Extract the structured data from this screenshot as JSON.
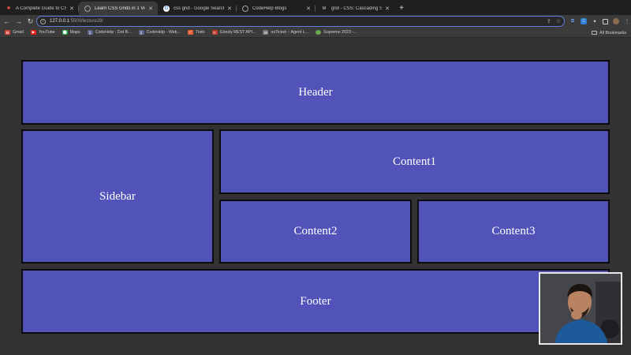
{
  "browser": {
    "tabs": [
      {
        "title": "A Complete Guide to CSS Grid",
        "icon": "asterisk-icon",
        "icon_color": "#e8553a",
        "active": false
      },
      {
        "title": "Learn CSS Grids in 1 Video",
        "icon": "globe-icon",
        "icon_color": "#9aa0a6",
        "active": true
      },
      {
        "title": "css grid - Google Search",
        "icon": "google-icon",
        "icon_color": "#ffffff",
        "active": false
      },
      {
        "title": "CodeHelp Blogs",
        "icon": "globe-icon",
        "icon_color": "#9aa0a6",
        "active": false
      },
      {
        "title": "grid - CSS: Cascading Style S",
        "icon": "mdn-icon",
        "icon_color": "#222222",
        "active": false
      }
    ],
    "new_tab_symbol": "+",
    "url": {
      "host": "127.0.0.1",
      "path": ":5500/lecture28/"
    },
    "bookmarks": [
      {
        "label": "Gmail",
        "icon": "gmail-icon",
        "color": "#d44638"
      },
      {
        "label": "YouTube",
        "icon": "youtube-icon",
        "color": "#e62117"
      },
      {
        "label": "Maps",
        "icon": "maps-icon",
        "color": "#34a853"
      },
      {
        "label": "CodeHelp - Dot B...",
        "icon": "codehelp-icon",
        "color": "#5a5f8a"
      },
      {
        "label": "CodeHelp - Web...",
        "icon": "codehelp-icon",
        "color": "#5a5f8a"
      },
      {
        "label": "Todo",
        "icon": "todo-icon",
        "color": "#e3623a"
      },
      {
        "label": "Grizzly REST API...",
        "icon": "grizzly-icon",
        "color": "#c0392b"
      },
      {
        "label": "osTicket :: Agent L...",
        "icon": "osticket-icon",
        "color": "#777777"
      },
      {
        "label": "Supreme 2023 -...",
        "icon": "supreme-icon",
        "color": "#6aa84f"
      }
    ],
    "all_bookmarks_label": "All Bookmarks"
  },
  "layout_boxes": {
    "header": "Header",
    "sidebar": "Sidebar",
    "content1": "Content1",
    "content2": "Content2",
    "content3": "Content3",
    "footer": "Footer"
  },
  "colors": {
    "box_fill": "#5253b8",
    "page_background": "#333232",
    "box_border": "#0c0c0c"
  },
  "webcam": {
    "icon": "person-on-camera-icon"
  }
}
